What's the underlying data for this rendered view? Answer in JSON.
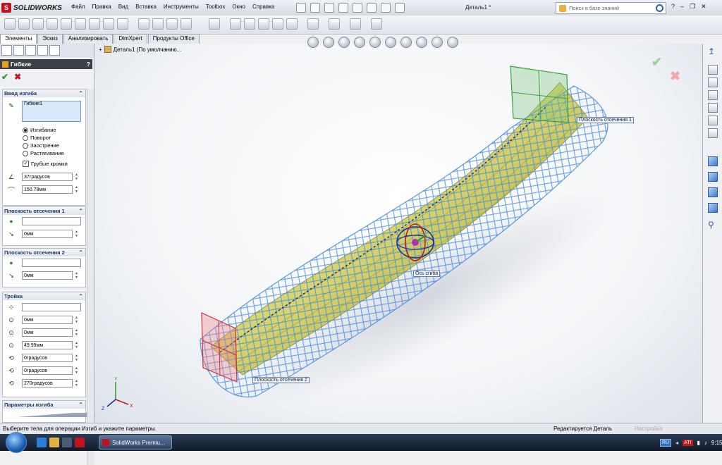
{
  "app": {
    "logo_text": "SOLIDWORKS",
    "doc_title": "Деталь1 *"
  },
  "menu": [
    "Файл",
    "Правка",
    "Вид",
    "Вставка",
    "Инструменты",
    "Toolbox",
    "Окно",
    "Справка"
  ],
  "search": {
    "placeholder": "Поиск в базе знаний"
  },
  "window_controls": {
    "help": "?",
    "minimize": "–",
    "restore": "❐",
    "close": "✕"
  },
  "tabs": [
    "Элементы",
    "Эскиз",
    "Анализировать",
    "DimXpert",
    "Продукты Office"
  ],
  "property_manager": {
    "title": "Гибкие",
    "help": "?",
    "ok": "✔",
    "cancel": "✖",
    "groups": {
      "bend_input": {
        "title": "Ввод изгиба",
        "bodies_value": "Гибкие1",
        "options": [
          "Изгибание",
          "Поворот",
          "Заострение",
          "Растягивание"
        ],
        "selected_option": "Изгибание",
        "rough_edges_label": "Грубые кромки",
        "rough_edges_checked": true,
        "angle": "37градусов",
        "radius": "150.78мм"
      },
      "trim_plane_1": {
        "title": "Плоскость отсечения 1",
        "offset": "0мм"
      },
      "trim_plane_2": {
        "title": "Плоскость отсечения 2",
        "offset": "0мм"
      },
      "triad": {
        "title": "Тройка",
        "x": "0мм",
        "y": "0мм",
        "z": "49.99мм",
        "rot_x": "0градусов",
        "rot_y": "0градусов",
        "rot_z": "270градусов"
      },
      "bend_params": {
        "title": "Параметры изгиба"
      }
    }
  },
  "viewport": {
    "tree_label": "Деталь1  (По умолчанию...",
    "callouts": {
      "plane1": "Плоскость отсечения 1",
      "plane2": "Плоскость отсечения 2",
      "axis": "Ось сгиба"
    },
    "ok": "✔",
    "cancel": "✖",
    "triad_labels": {
      "x": "X",
      "y": "Y",
      "z": "Z"
    }
  },
  "status": {
    "message": "Выберите тела для операции Изгиб и укажите параметры.",
    "editing": "Редактируется Деталь",
    "settings": "Настройка"
  },
  "taskbar": {
    "app_label": "SolidWorks Premiu...",
    "lang": "RU",
    "ati": "ATI",
    "time": "9:15"
  },
  "colors": {
    "plane1": "#3aa03a",
    "plane2": "#d0303a",
    "body": "#d7d36a",
    "mesh": "#4a8fe0"
  }
}
